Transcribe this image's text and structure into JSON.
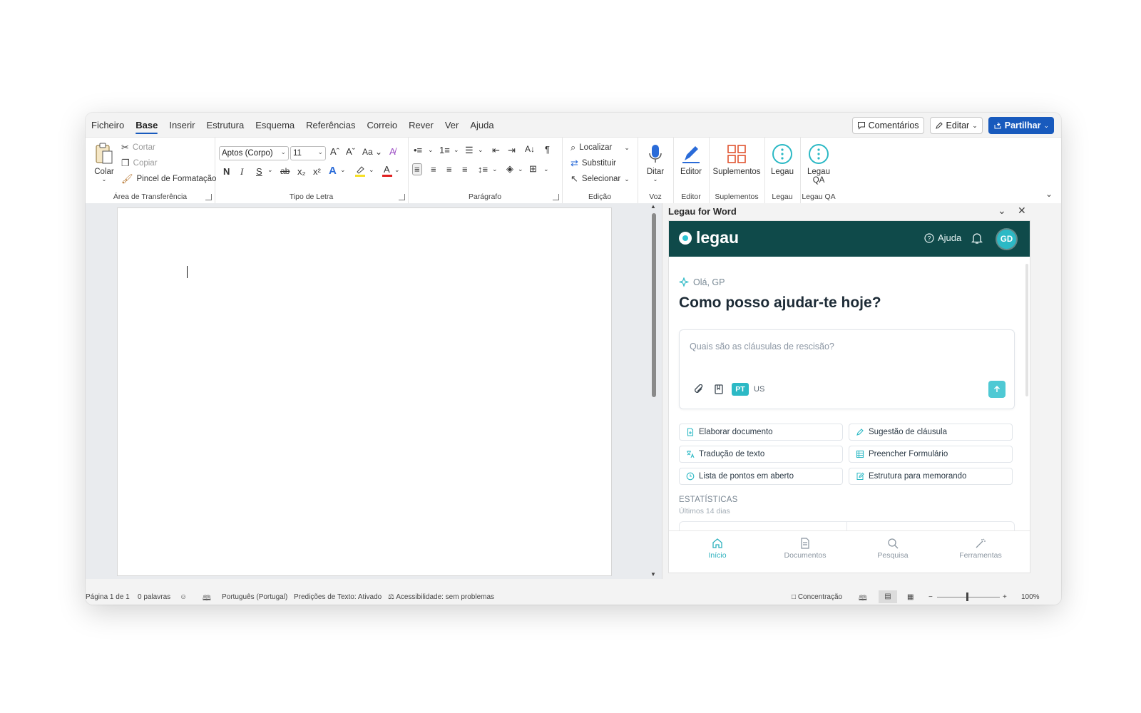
{
  "menu": [
    "Ficheiro",
    "Base",
    "Inserir",
    "Estrutura",
    "Esquema",
    "Referências",
    "Correio",
    "Rever",
    "Ver",
    "Ajuda"
  ],
  "menu_active": "Base",
  "top_buttons": {
    "comments": "Comentários",
    "edit": "Editar",
    "share": "Partilhar"
  },
  "ribbon": {
    "clipboard": {
      "paste": "Colar",
      "cut": "Cortar",
      "copy": "Copiar",
      "format_painter": "Pincel de Formatação",
      "label": "Área de Transferência"
    },
    "font": {
      "name": "Aptos (Corpo)",
      "size": "11",
      "label": "Tipo de Letra",
      "bold": "N",
      "italic": "I",
      "underline": "S",
      "strike": "ab",
      "case": "Aa"
    },
    "paragraph": {
      "label": "Parágrafo"
    },
    "editing": {
      "find": "Localizar",
      "replace": "Substituir",
      "select": "Selecionar",
      "label": "Edição"
    },
    "voice": {
      "dictate": "Ditar",
      "label": "Voz"
    },
    "editor": {
      "btn": "Editor",
      "label": "Editor"
    },
    "addins": {
      "btn": "Suplementos",
      "label": "Suplementos"
    },
    "legau": {
      "btn": "Legau",
      "label": "Legau"
    },
    "legau_qa": {
      "btn_line1": "Legau",
      "btn_line2": "QA",
      "label": "Legau QA"
    }
  },
  "pane": {
    "title": "Legau for Word",
    "logo": "legau",
    "help": "Ajuda",
    "avatar": "GD",
    "greeting": "Olá, GP",
    "headline": "Como posso ajudar-te hoje?",
    "prompt_placeholder": "Quais são as cláusulas de rescisão?",
    "lang_selected": "PT",
    "lang_other": "US",
    "actions": [
      {
        "label": "Elaborar documento",
        "icon": "file-plus-icon"
      },
      {
        "label": "Sugestão de cláusula",
        "icon": "pen-icon"
      },
      {
        "label": "Tradução de texto",
        "icon": "translate-icon"
      },
      {
        "label": "Preencher Formulário",
        "icon": "table-icon"
      },
      {
        "label": "Lista de pontos em aberto",
        "icon": "clock-icon"
      },
      {
        "label": "Estrutura para memorando",
        "icon": "edit-doc-icon"
      }
    ],
    "stats_title": "ESTATÍSTICAS",
    "stats_sub": "Últimos 14 dias",
    "nav": [
      {
        "label": "Início",
        "icon": "home-icon",
        "active": true
      },
      {
        "label": "Documentos",
        "icon": "document-icon",
        "active": false
      },
      {
        "label": "Pesquisa",
        "icon": "search-icon",
        "active": false
      },
      {
        "label": "Ferramentas",
        "icon": "magic-wand-icon",
        "active": false
      }
    ]
  },
  "status": {
    "page": "Página 1 de 1",
    "words": "0 palavras",
    "language": "Português (Portugal)",
    "predictions": "Predições de Texto: Ativado",
    "accessibility": "Acessibilidade: sem problemas",
    "focus": "Concentração",
    "zoom": "100%"
  },
  "colors": {
    "word_blue": "#185abd",
    "legau_dark": "#0f4a4a",
    "legau_teal": "#2cb9c5",
    "addin_orange": "#e0532f"
  }
}
